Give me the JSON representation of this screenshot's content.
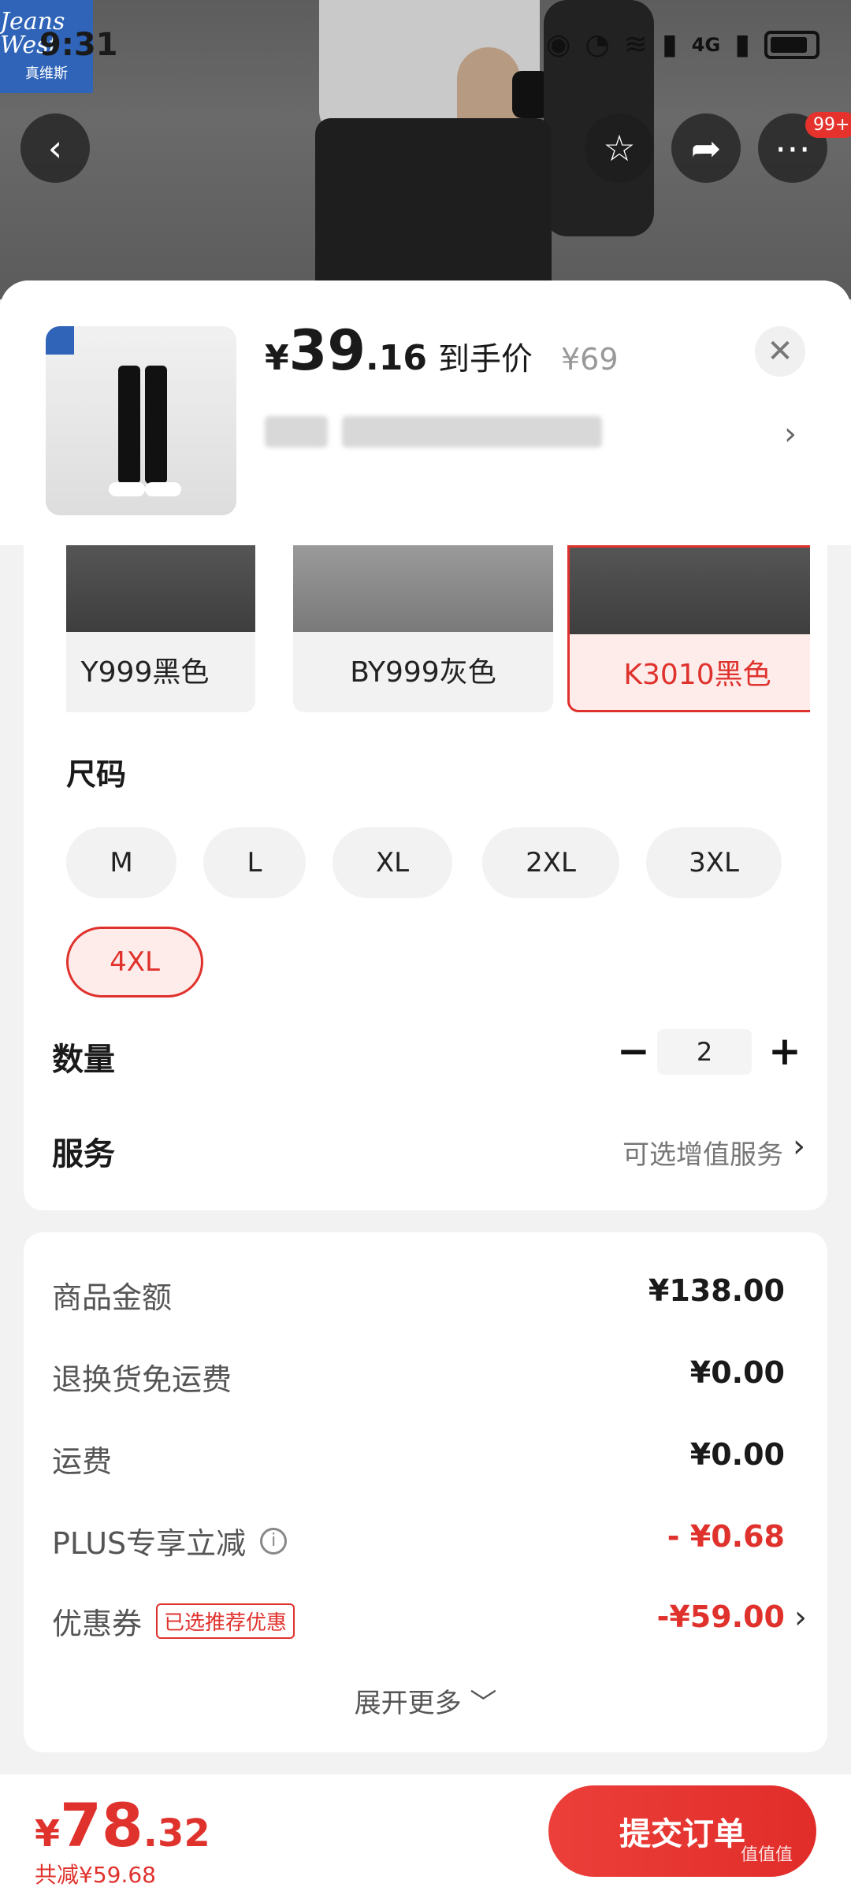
{
  "status_bar": {
    "time": "9:31",
    "network": "4G"
  },
  "brand": {
    "logo_line1": "Jeans West",
    "logo_line2": "真维斯"
  },
  "top_nav": {
    "more_badge": "99+"
  },
  "sku_header": {
    "price_currency": "¥",
    "price_integer": "39",
    "price_decimal": ".16",
    "price_label": "到手价",
    "original_price": "¥69",
    "close_glyph": "✕"
  },
  "colors": [
    {
      "label": "Y999黑色",
      "selected": false
    },
    {
      "label": "BY999灰色",
      "selected": false
    },
    {
      "label": "K3010黑色",
      "selected": true
    }
  ],
  "size": {
    "title": "尺码",
    "options": [
      "M",
      "L",
      "XL",
      "2XL",
      "3XL",
      "4XL"
    ],
    "selected": "4XL"
  },
  "quantity": {
    "title": "数量",
    "value": "2",
    "minus": "−",
    "plus": "+"
  },
  "service": {
    "title": "服务",
    "hint": "可选增值服务"
  },
  "price_detail": {
    "rows": [
      {
        "label": "商品金额",
        "value": "¥138.00"
      },
      {
        "label": "退换货免运费",
        "value": "¥0.00"
      },
      {
        "label": "运费",
        "value": "¥0.00"
      },
      {
        "label": "PLUS专享立减",
        "value": "- ¥0.68"
      },
      {
        "label": "优惠券",
        "tag": "已选推荐优惠",
        "value": "-¥59.00"
      }
    ],
    "expand_more": "展开更多 ﹀"
  },
  "bottom_bar": {
    "total_currency": "¥",
    "total_integer": "78",
    "total_decimal": ".32",
    "saved": "共减¥59.68",
    "submit": "提交订单"
  },
  "watermark": "值值值"
}
